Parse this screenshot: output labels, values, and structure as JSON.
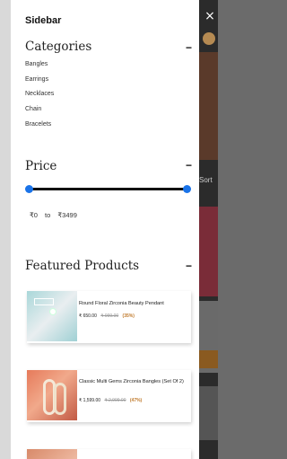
{
  "sidebar": {
    "title": "Sidebar",
    "categories": {
      "title": "Categories",
      "collapse": "−",
      "items": [
        "Bangles",
        "Earrings",
        "Necklaces",
        "Chain",
        "Bracelets"
      ]
    },
    "price": {
      "title": "Price",
      "collapse": "−",
      "min_label": "₹0",
      "to_label": "to",
      "max_label": "₹3499",
      "range_min_fraction": 0,
      "range_max_fraction": 1
    },
    "featured": {
      "title": "Featured Products",
      "collapse": "−",
      "products": [
        {
          "name": "Round Floral Zirconia Beauty Pendant",
          "price": "₹ 650.00",
          "mrp": "₹ 999.00",
          "discount": "(35%)"
        },
        {
          "name": "Classic Multi Gems Zirconia Bangles (Set Of 2)",
          "price": "₹ 1,599.00",
          "mrp": "₹ 2,999.00",
          "discount": "(47%)"
        }
      ]
    }
  },
  "background": {
    "close": "×",
    "sort_label": "Sort"
  },
  "colors": {
    "accent": "#1a73e8",
    "discount": "#c07a2c"
  }
}
